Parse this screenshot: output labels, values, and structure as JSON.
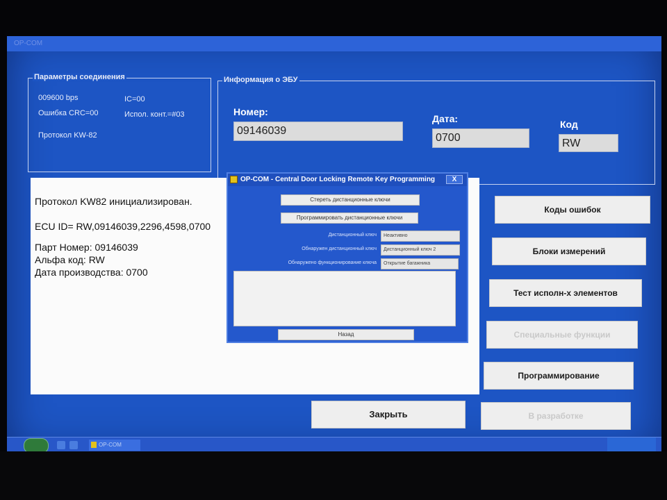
{
  "window": {
    "title": "OP-COM"
  },
  "connection": {
    "legend": "Параметры соединения",
    "baud": "009600 bps",
    "ic": "IC=00",
    "crc": "Ошибка CRC=00",
    "contact": "Испол. конт.=#03",
    "protocol": "Протокол KW-82"
  },
  "ecu_info": {
    "legend": "Информация о ЭБУ",
    "number_label": "Номер:",
    "number_value": "09146039",
    "date_label": "Дата:",
    "date_value": "0700",
    "code_label": "Код",
    "code_value": "RW"
  },
  "log": {
    "lines": [
      "Протокол KW82 инициализирован.",
      "ECU ID= RW,09146039,2296,4598,0700",
      "Парт Номер: 09146039",
      "Альфа код: RW",
      "Дата производства: 0700"
    ]
  },
  "buttons": {
    "fault_codes": "Коды ошибок",
    "measure_blocks": "Блоки измерений",
    "actuator_test": "Тест исполн-х элементов",
    "special_functions": "Специальные функции",
    "programming": "Программирование",
    "in_development": "В разработке",
    "close": "Закрыть"
  },
  "dialog": {
    "title": "OP-COM - Central Door Locking Remote Key Programming",
    "close_glyph": "X",
    "erase_button": "Стереть дистанционные ключи",
    "program_button": "Программировать дистанционные ключи",
    "remote_key_label": "Дистанционный ключ",
    "remote_key_value": "Неактивно",
    "detected_key_label": "Обнаружен дистанционный ключ",
    "detected_key_value": "Дистанционный ключ 2",
    "detected_function_label": "Обнаружено функционирование ключа",
    "detected_function_value": "Открытие багажника",
    "back_button": "Назад"
  },
  "taskbar": {
    "active_item": "OP-COM"
  }
}
